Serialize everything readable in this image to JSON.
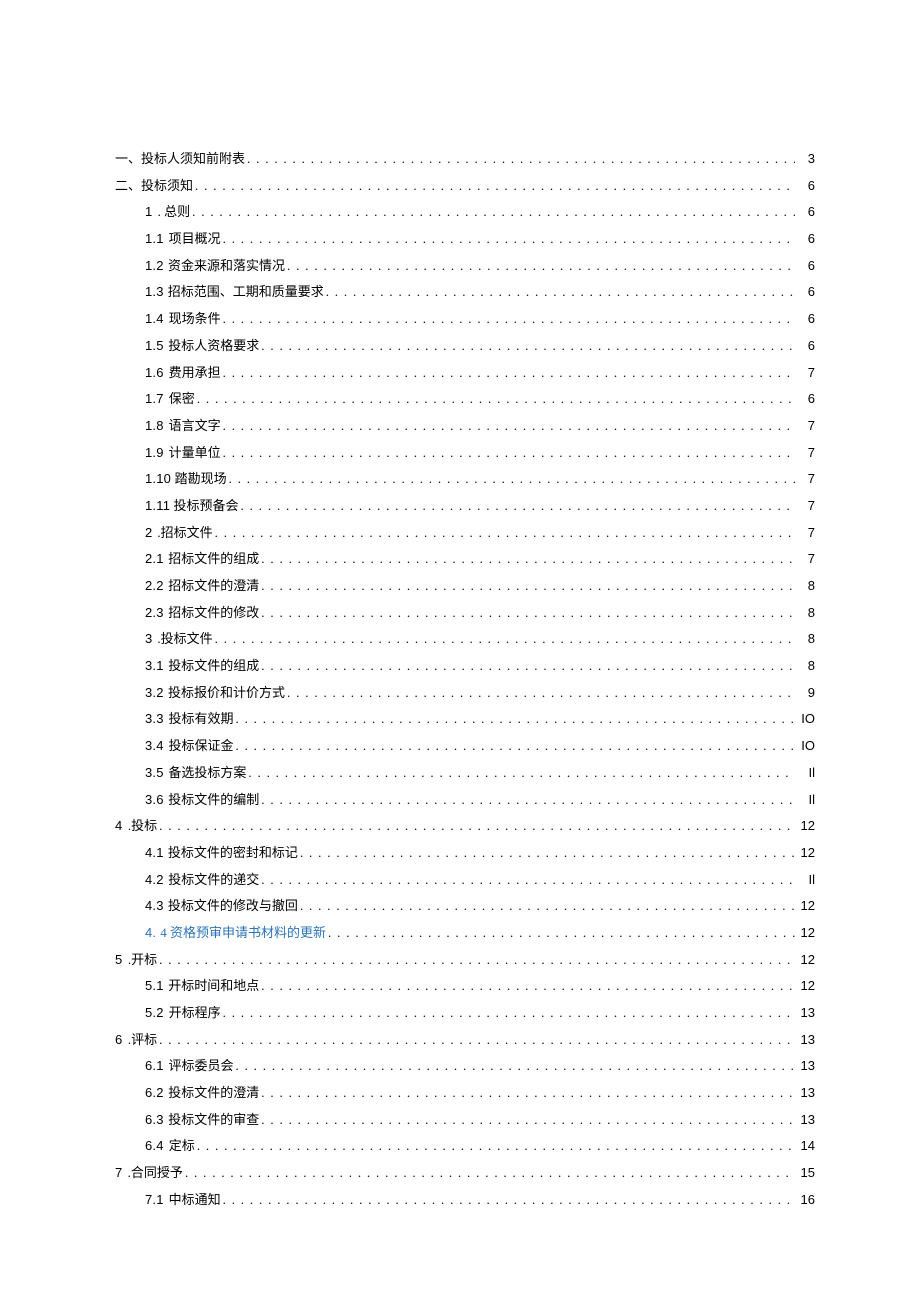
{
  "toc": [
    {
      "level": 0,
      "num": "一、",
      "title": "投标人须知前附表",
      "page": "3",
      "numClass": "",
      "indentClass": "indent-0",
      "gap": "none"
    },
    {
      "level": 0,
      "num": "二、",
      "title": "投标须知",
      "page": "6",
      "numClass": "",
      "indentClass": "indent-0",
      "gap": "none"
    },
    {
      "level": 1,
      "num": "1",
      "title": ". 总则",
      "page": "6",
      "numClass": "num",
      "indentClass": "indent-1",
      "gap": "big"
    },
    {
      "level": 2,
      "num": "1.1",
      "title": "项目概况",
      "page": "6",
      "numClass": "num",
      "indentClass": "indent-2",
      "gap": "big"
    },
    {
      "level": 2,
      "num": "1.2",
      "title": "资金来源和落实情况",
      "page": "6",
      "numClass": "num",
      "indentClass": "indent-2",
      "gap": "big"
    },
    {
      "level": 2,
      "num": "1.3",
      "title": "招标范围、工期和质量要求",
      "page": "6",
      "numClass": "num",
      "indentClass": "indent-2",
      "gap": "big"
    },
    {
      "level": 2,
      "num": "1.4",
      "title": "现场条件",
      "page": "6",
      "numClass": "num",
      "indentClass": "indent-2",
      "gap": "big"
    },
    {
      "level": 2,
      "num": "1.5",
      "title": "投标人资格要求",
      "page": "6",
      "numClass": "num",
      "indentClass": "indent-2",
      "gap": "big"
    },
    {
      "level": 2,
      "num": "1.6",
      "title": "费用承担",
      "page": "7",
      "numClass": "num",
      "indentClass": "indent-2",
      "gap": "big"
    },
    {
      "level": 2,
      "num": "1.7",
      "title": "保密",
      "page": "6",
      "numClass": "num",
      "indentClass": "indent-2",
      "gap": "big"
    },
    {
      "level": 2,
      "num": "1.8",
      "title": "语言文字",
      "page": "7",
      "numClass": "num",
      "indentClass": "indent-2",
      "gap": "big"
    },
    {
      "level": 2,
      "num": "1.9",
      "title": "计量单位",
      "page": "7",
      "numClass": "num",
      "indentClass": "indent-2",
      "gap": "big"
    },
    {
      "level": 2,
      "num": "1.10",
      "title": "踏勘现场",
      "page": "7",
      "numClass": "num",
      "indentClass": "indent-2",
      "gap": "small"
    },
    {
      "level": 2,
      "num": "1.11",
      "title": "投标预备会",
      "page": "7",
      "numClass": "num",
      "indentClass": "indent-2",
      "gap": "small"
    },
    {
      "level": 1,
      "num": "2",
      "title": ".招标文件",
      "page": "7",
      "numClass": "num",
      "indentClass": "indent-1",
      "gap": "big"
    },
    {
      "level": 2,
      "num": "2.1",
      "title": "招标文件的组成",
      "page": "7",
      "numClass": "num",
      "indentClass": "indent-2",
      "gap": "big"
    },
    {
      "level": 2,
      "num": "2.2",
      "title": "招标文件的澄清",
      "page": "8",
      "numClass": "num",
      "indentClass": "indent-2",
      "gap": "big"
    },
    {
      "level": 2,
      "num": "2.3",
      "title": "招标文件的修改",
      "page": "8",
      "numClass": "num",
      "indentClass": "indent-2",
      "gap": "big"
    },
    {
      "level": 1,
      "num": "3",
      "title": ".投标文件",
      "page": "8",
      "numClass": "num",
      "indentClass": "indent-1",
      "gap": "big"
    },
    {
      "level": 2,
      "num": "3.1",
      "title": "投标文件的组成",
      "page": "8",
      "numClass": "num",
      "indentClass": "indent-2",
      "gap": "big"
    },
    {
      "level": 2,
      "num": "3.2",
      "title": "投标报价和计价方式",
      "page": "9",
      "numClass": "num",
      "indentClass": "indent-2",
      "gap": "big"
    },
    {
      "level": 2,
      "num": "3.3",
      "title": "投标有效期",
      "page": "IO",
      "numClass": "num",
      "indentClass": "indent-2",
      "gap": "big"
    },
    {
      "level": 2,
      "num": "3.4",
      "title": "投标保证金",
      "page": "IO",
      "numClass": "num",
      "indentClass": "indent-2",
      "gap": "big"
    },
    {
      "level": 2,
      "num": "3.5",
      "title": "备选投标方案",
      "page": "Il",
      "numClass": "num",
      "indentClass": "indent-2",
      "gap": "big"
    },
    {
      "level": 2,
      "num": "3.6",
      "title": "投标文件的编制",
      "page": "Il",
      "numClass": "num",
      "indentClass": "indent-2",
      "gap": "big"
    },
    {
      "level": 0,
      "num": "4",
      "title": ".投标",
      "page": "12",
      "numClass": "num",
      "indentClass": "indent-sec4",
      "gap": "big"
    },
    {
      "level": 2,
      "num": "4.1",
      "title": "投标文件的密封和标记",
      "page": "12",
      "numClass": "num",
      "indentClass": "indent-2",
      "gap": "big"
    },
    {
      "level": 2,
      "num": "4.2",
      "title": "投标文件的递交",
      "page": "Il",
      "numClass": "num",
      "indentClass": "indent-2",
      "gap": "big"
    },
    {
      "level": 2,
      "num": "4.3",
      "title": "投标文件的修改与撤回",
      "page": "12",
      "numClass": "num",
      "indentClass": "indent-2",
      "gap": "big"
    },
    {
      "level": 2,
      "num": "4.",
      "title": "4 资格预审申请书材料的更新",
      "page": "12",
      "numClass": "num blue",
      "indentClass": "indent-2",
      "gap": "big",
      "titleClass": "blue"
    },
    {
      "level": 0,
      "num": "5",
      "title": ".开标",
      "page": "12",
      "numClass": "num",
      "indentClass": "indent-sec4",
      "gap": "big"
    },
    {
      "level": 2,
      "num": "5.1",
      "title": "开标时间和地点",
      "page": "12",
      "numClass": "num",
      "indentClass": "indent-2",
      "gap": "big"
    },
    {
      "level": 2,
      "num": "5.2",
      "title": "开标程序",
      "page": "13",
      "numClass": "num",
      "indentClass": "indent-2",
      "gap": "big"
    },
    {
      "level": 0,
      "num": "6",
      "title": ".评标",
      "page": "13",
      "numClass": "num",
      "indentClass": "indent-sec4",
      "gap": "big"
    },
    {
      "level": 2,
      "num": "6.1",
      "title": "评标委员会",
      "page": "13",
      "numClass": "num",
      "indentClass": "indent-2",
      "gap": "big"
    },
    {
      "level": 2,
      "num": "6.2",
      "title": "投标文件的澄清",
      "page": "13",
      "numClass": "num",
      "indentClass": "indent-2",
      "gap": "big"
    },
    {
      "level": 2,
      "num": "6.3",
      "title": "投标文件的审查",
      "page": "13",
      "numClass": "num",
      "indentClass": "indent-2",
      "gap": "big"
    },
    {
      "level": 2,
      "num": "6.4",
      "title": "定标",
      "page": "14",
      "numClass": "num",
      "indentClass": "indent-2",
      "gap": "big"
    },
    {
      "level": 0,
      "num": "7",
      "title": ".合同授予",
      "page": "15",
      "numClass": "num",
      "indentClass": "indent-sec4",
      "gap": "big"
    },
    {
      "level": 2,
      "num": "7.1",
      "title": "中标通知",
      "page": "16",
      "numClass": "num",
      "indentClass": "indent-2",
      "gap": "big"
    }
  ]
}
